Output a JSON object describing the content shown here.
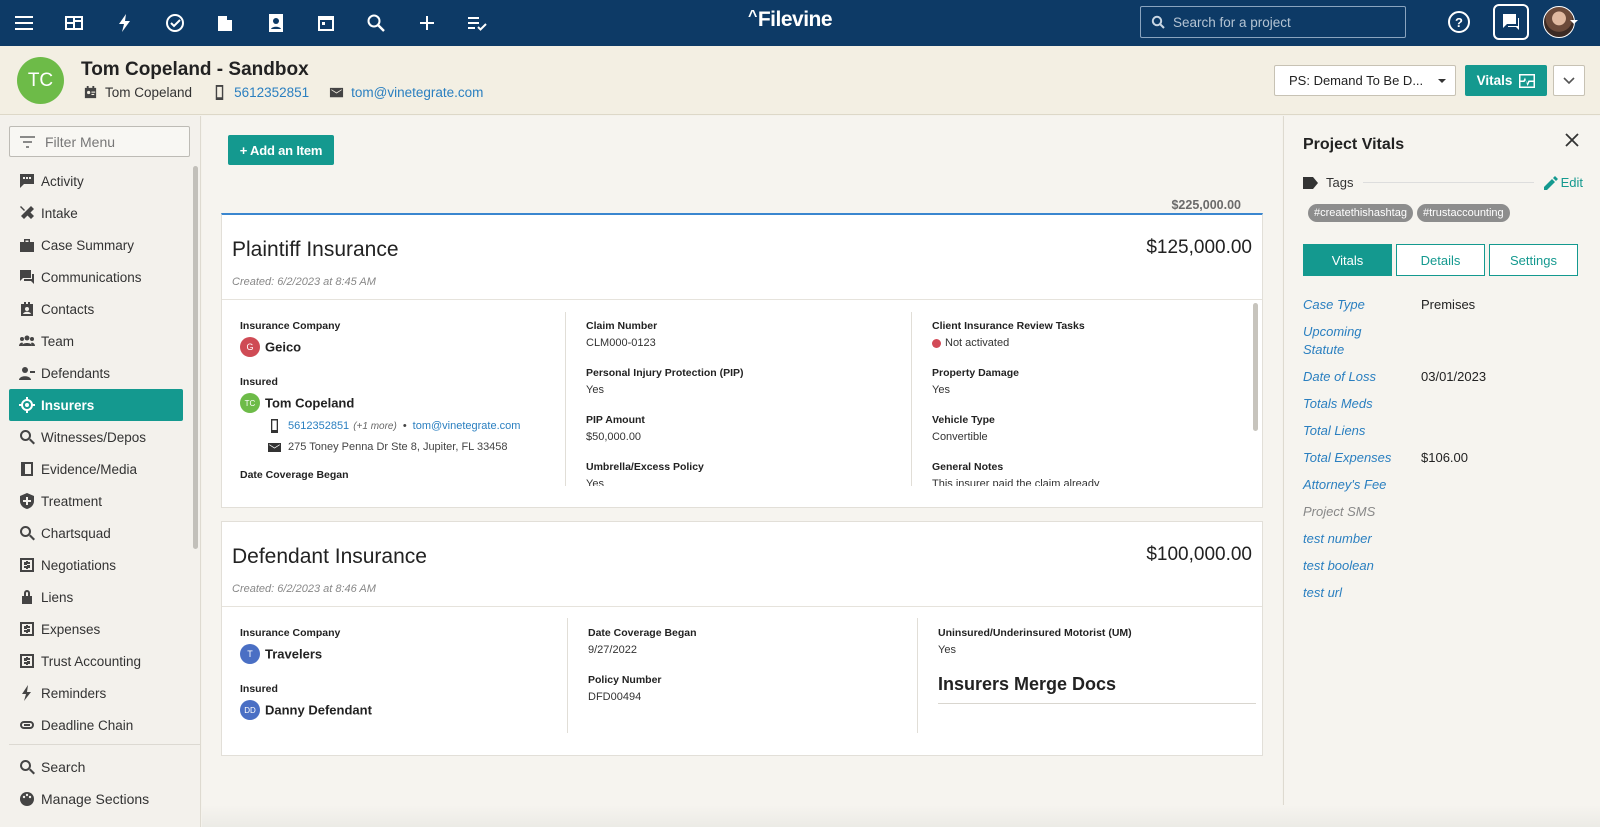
{
  "topbar": {
    "logo": "Filevine",
    "search_placeholder": "Search for a project",
    "icons": [
      "menu-icon",
      "dashboard-icon",
      "lightning-icon",
      "check-circle-icon",
      "briefcase-icon",
      "contacts-icon",
      "calendar-icon",
      "search-icon",
      "plus-icon",
      "tasks-icon"
    ]
  },
  "project": {
    "initials": "TC",
    "title": "Tom Copeland - Sandbox",
    "client": "Tom Copeland",
    "phone": "5612352851",
    "email": "tom@vinetegrate.com",
    "phase": "PS: Demand To Be D...",
    "vitals_button": "Vitals"
  },
  "sidebar": {
    "filter_placeholder": "Filter Menu",
    "items": [
      {
        "label": "Activity",
        "icon": "activity-icon"
      },
      {
        "label": "Intake",
        "icon": "intake-icon"
      },
      {
        "label": "Case Summary",
        "icon": "briefcase-icon"
      },
      {
        "label": "Communications",
        "icon": "chat-icon"
      },
      {
        "label": "Contacts",
        "icon": "contacts-icon"
      },
      {
        "label": "Team",
        "icon": "team-icon"
      },
      {
        "label": "Defendants",
        "icon": "person-icon"
      },
      {
        "label": "Insurers",
        "icon": "target-icon",
        "active": true
      },
      {
        "label": "Witnesses/Depos",
        "icon": "search-icon"
      },
      {
        "label": "Evidence/Media",
        "icon": "book-icon"
      },
      {
        "label": "Treatment",
        "icon": "shield-icon"
      },
      {
        "label": "Chartsquad",
        "icon": "search-icon"
      },
      {
        "label": "Negotiations",
        "icon": "dollar-icon"
      },
      {
        "label": "Liens",
        "icon": "lock-icon"
      },
      {
        "label": "Expenses",
        "icon": "dollar-icon"
      },
      {
        "label": "Trust Accounting",
        "icon": "dollar-icon"
      },
      {
        "label": "Reminders",
        "icon": "lightning-icon"
      },
      {
        "label": "Deadline Chain",
        "icon": "link-icon"
      }
    ],
    "bottom": [
      {
        "label": "Search",
        "icon": "search-icon"
      },
      {
        "label": "Manage Sections",
        "icon": "palette-icon"
      }
    ]
  },
  "main": {
    "add_button": "+ Add an Item",
    "total": "$225,000.00",
    "plaintiff": {
      "title": "Plaintiff Insurance",
      "amount": "$125,000.00",
      "created": "Created: 6/2/2023 at 8:45 AM",
      "insurance_company_label": "Insurance Company",
      "company_initial": "G",
      "company": "Geico",
      "insured_label": "Insured",
      "insured_initials": "TC",
      "insured": "Tom Copeland",
      "insured_phone": "5612352851",
      "insured_more": "(+1 more)",
      "insured_sep": "•",
      "insured_email": "tom@vinetegrate.com",
      "insured_address": "275 Toney Penna Dr Ste 8, Jupiter, FL 33458",
      "date_coverage_label": "Date Coverage Began",
      "claim_number_label": "Claim Number",
      "claim_number": "CLM000-0123",
      "pip_label": "Personal Injury Protection (PIP)",
      "pip": "Yes",
      "pip_amount_label": "PIP Amount",
      "pip_amount": "$50,000.00",
      "umbrella_label": "Umbrella/Excess Policy",
      "umbrella": "Yes",
      "review_tasks_label": "Client Insurance Review Tasks",
      "review_tasks": "Not activated",
      "property_damage_label": "Property Damage",
      "property_damage": "Yes",
      "vehicle_type_label": "Vehicle Type",
      "vehicle_type": "Convertible",
      "general_notes_label": "General Notes",
      "general_notes": "This insurer paid the claim already"
    },
    "defendant": {
      "title": "Defendant Insurance",
      "amount": "$100,000.00",
      "created": "Created: 6/2/2023 at 8:46 AM",
      "insurance_company_label": "Insurance Company",
      "company_initial": "T",
      "company": "Travelers",
      "insured_label": "Insured",
      "insured_initials": "DD",
      "insured": "Danny Defendant",
      "date_coverage_label": "Date Coverage Began",
      "date_coverage": "9/27/2022",
      "policy_number_label": "Policy Number",
      "policy_number": "DFD00494",
      "um_label": "Uninsured/Underinsured Motorist (UM)",
      "um": "Yes",
      "merge_docs": "Insurers Merge Docs"
    }
  },
  "vitals": {
    "title": "Project Vitals",
    "tags_label": "Tags",
    "edit": "Edit",
    "tags": [
      "#createthishashtag",
      "#trustaccounting"
    ],
    "tabs": [
      "Vitals",
      "Details",
      "Settings"
    ],
    "rows": [
      {
        "label": "Case Type",
        "value": "Premises"
      },
      {
        "label": "Upcoming Statute",
        "value": ""
      },
      {
        "label": "Date of Loss",
        "value": "03/01/2023"
      },
      {
        "label": "Totals Meds",
        "value": ""
      },
      {
        "label": "Total Liens",
        "value": ""
      },
      {
        "label": "Total Expenses",
        "value": "$106.00"
      },
      {
        "label": "Attorney's Fee",
        "value": ""
      },
      {
        "label": "Project SMS",
        "value": ""
      },
      {
        "label": "test number",
        "value": ""
      },
      {
        "label": "test boolean",
        "value": ""
      },
      {
        "label": "test url",
        "value": ""
      }
    ]
  },
  "colors": {
    "topbar": "#0d3a66",
    "accent": "#14998f",
    "link": "#2a7fc0",
    "avatar_green": "#6dbb48"
  }
}
